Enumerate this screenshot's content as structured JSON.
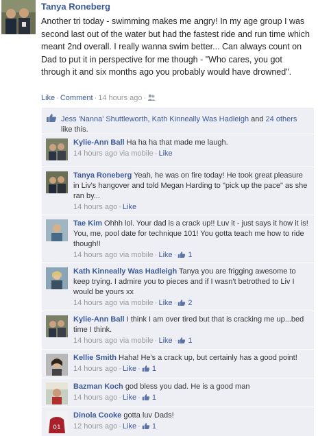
{
  "post": {
    "author": "Tanya Roneberg",
    "text": "Another tri today - swimming makes me angry! In my age group I was second last out of the water but had the fastest ride and run time which meant 2nd overall. I really wanna swim better... Can always count on Dad to put it in perspective for me though - \"Who cares, you got through it and six months ago you probably would have drowned\".",
    "actions": {
      "like": "Like",
      "comment": "Comment",
      "time": "14 hours ago"
    }
  },
  "likes": {
    "name1": "Jess 'Nanna' Shuttleworth",
    "name2": "Kath Kinneally Was Hadleigh",
    "others": "24 others",
    "and": "and",
    "sep": ",",
    "suffix": "like this."
  },
  "comments": [
    {
      "name": "Kylie-Ann Ball",
      "text": "Ha ha ha that made me laugh.",
      "time": "14 hours ago via mobile",
      "like": "Like",
      "likes": ""
    },
    {
      "name": "Tanya Roneberg",
      "text": "Yeah, he was on fire today! He took great pleasure in Liv's hangover and told Megan Harding to \"pick up the pace\" as she ran by...",
      "time": "14 hours ago",
      "like": "Like",
      "likes": ""
    },
    {
      "name": "Tae Kim",
      "text": "Ohhh lol. Your dad is a crack up!! Luv it - just says it how it is! You, me, pool date for technique 101! You gotta teach me how to ride though!!",
      "time": "14 hours ago via mobile",
      "like": "Like",
      "likes": "1"
    },
    {
      "name": "Kath Kinneally Was Hadleigh",
      "text": "Tanya you are frigging awesome to keep trying. I admire you to pieces and if I wasn't betrothed to Liv I would be yours xx",
      "time": "14 hours ago via mobile",
      "like": "Like",
      "likes": "2"
    },
    {
      "name": "Kylie-Ann Ball",
      "text": "I think I am over tired but that is cracking me up...bed time I think.",
      "time": "14 hours ago via mobile",
      "like": "Like",
      "likes": "1"
    },
    {
      "name": "Kellie Smith",
      "text": "Haha! He's a crack up, but certainly has a good point!",
      "time": "14 hours ago",
      "like": "Like",
      "likes": "1"
    },
    {
      "name": "Bazman Koch",
      "text": "god bless you dad. He is a good man",
      "time": "14 hours ago",
      "like": "Like",
      "likes": "1"
    },
    {
      "name": "Dinola Cooke",
      "text": "gotta luv Dads!",
      "time": "12 hours ago",
      "like": "Like",
      "likes": "1"
    }
  ],
  "colors": {
    "link": "#3b5998",
    "ufi_bg": "#edeff4",
    "meta": "#999999"
  },
  "icons": {
    "thumb": "thumbs-up-icon",
    "friends": "friends-icon"
  }
}
